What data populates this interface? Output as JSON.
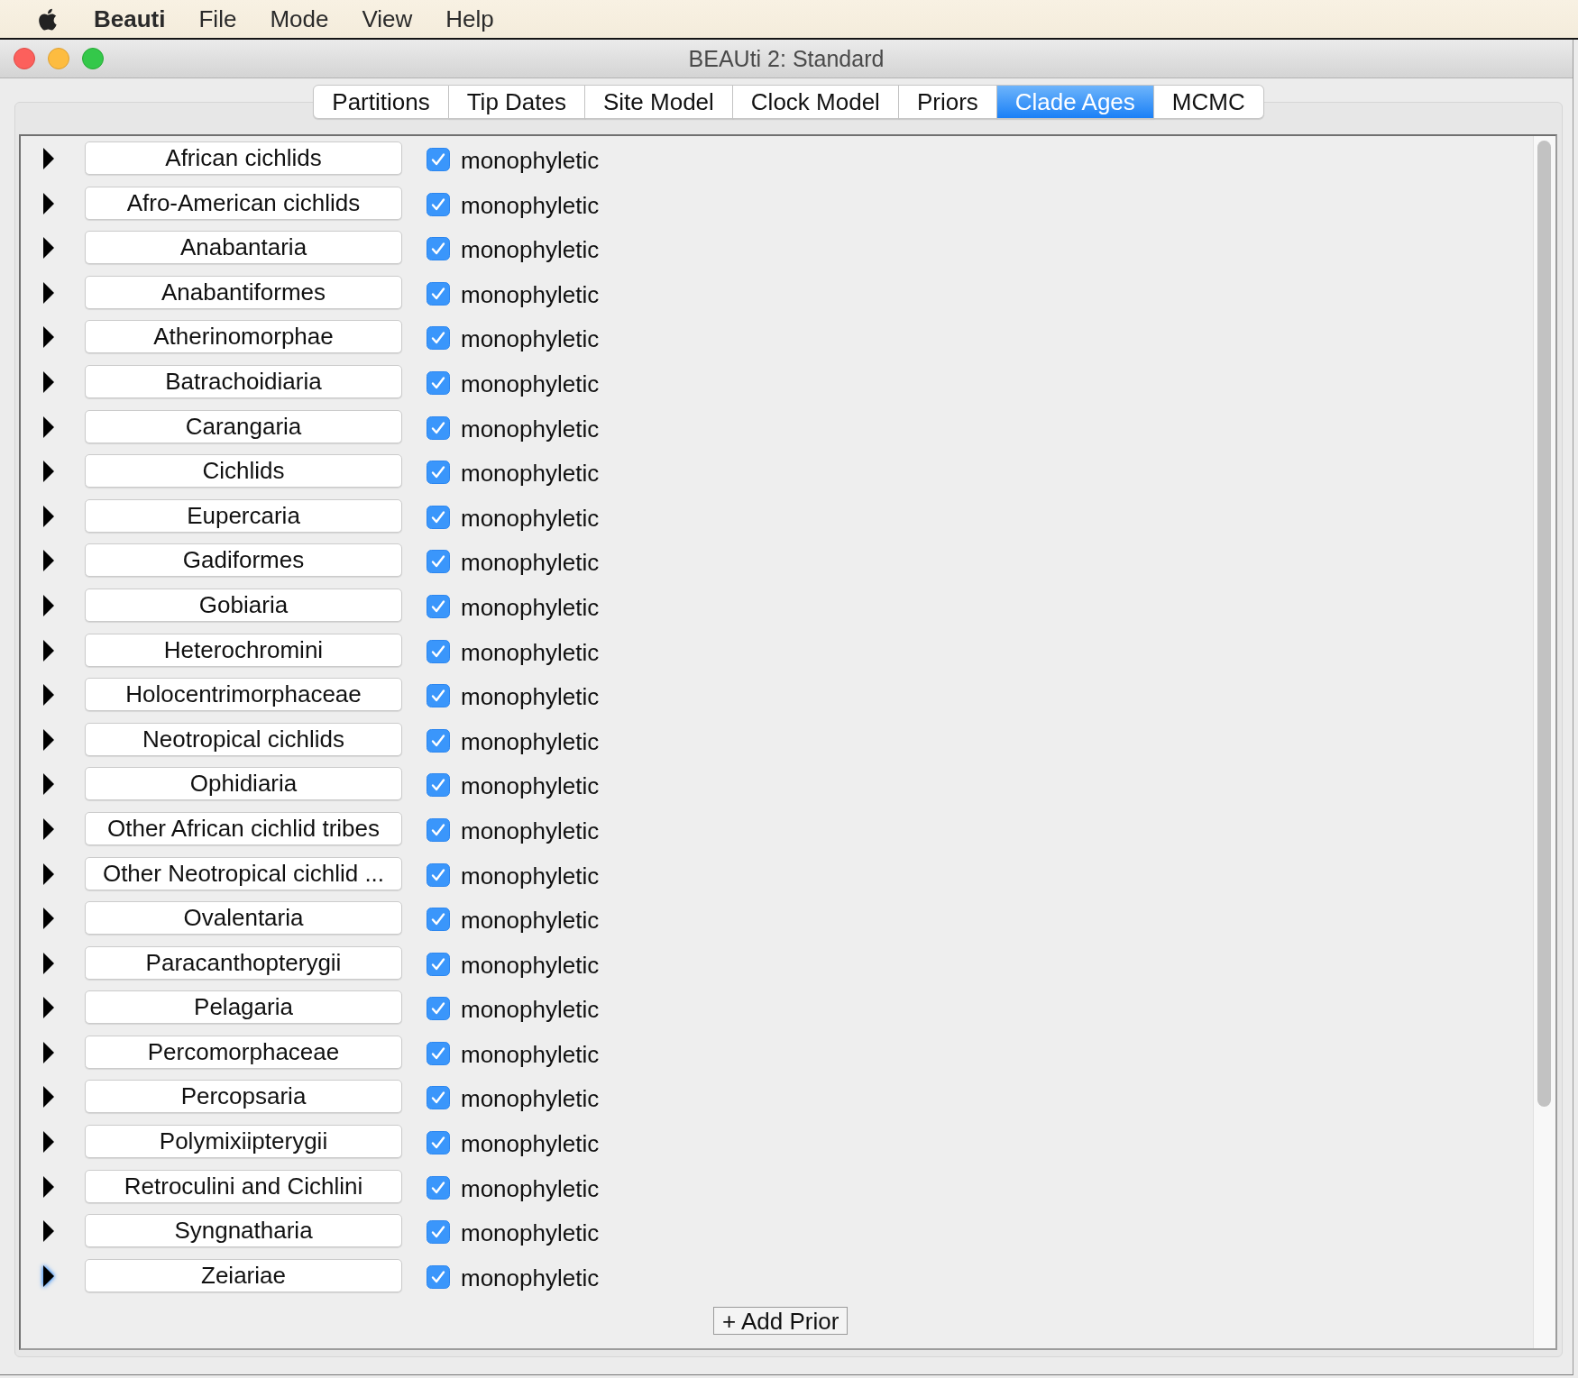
{
  "menu_bar": {
    "app_name": "Beauti",
    "items": [
      "File",
      "Mode",
      "View",
      "Help"
    ]
  },
  "window": {
    "title": "BEAUti 2: Standard"
  },
  "tabs": [
    {
      "label": "Partitions",
      "selected": false
    },
    {
      "label": "Tip Dates",
      "selected": false
    },
    {
      "label": "Site Model",
      "selected": false
    },
    {
      "label": "Clock Model",
      "selected": false
    },
    {
      "label": "Priors",
      "selected": false
    },
    {
      "label": "Clade Ages",
      "selected": true
    },
    {
      "label": "MCMC",
      "selected": false
    }
  ],
  "clades": [
    {
      "name": "African cichlids",
      "expanded": false,
      "focused": false,
      "checkbox": {
        "label": "monophyletic",
        "checked": true
      }
    },
    {
      "name": "Afro-American cichlids",
      "expanded": false,
      "focused": false,
      "checkbox": {
        "label": "monophyletic",
        "checked": true
      }
    },
    {
      "name": "Anabantaria",
      "expanded": false,
      "focused": false,
      "checkbox": {
        "label": "monophyletic",
        "checked": true
      }
    },
    {
      "name": "Anabantiformes",
      "expanded": false,
      "focused": false,
      "checkbox": {
        "label": "monophyletic",
        "checked": true
      }
    },
    {
      "name": "Atherinomorphae",
      "expanded": false,
      "focused": false,
      "checkbox": {
        "label": "monophyletic",
        "checked": true
      }
    },
    {
      "name": "Batrachoidiaria",
      "expanded": false,
      "focused": false,
      "checkbox": {
        "label": "monophyletic",
        "checked": true
      }
    },
    {
      "name": "Carangaria",
      "expanded": false,
      "focused": false,
      "checkbox": {
        "label": "monophyletic",
        "checked": true
      }
    },
    {
      "name": "Cichlids",
      "expanded": false,
      "focused": false,
      "checkbox": {
        "label": "monophyletic",
        "checked": true
      }
    },
    {
      "name": "Eupercaria",
      "expanded": false,
      "focused": false,
      "checkbox": {
        "label": "monophyletic",
        "checked": true
      }
    },
    {
      "name": "Gadiformes",
      "expanded": false,
      "focused": false,
      "checkbox": {
        "label": "monophyletic",
        "checked": true
      }
    },
    {
      "name": "Gobiaria",
      "expanded": false,
      "focused": false,
      "checkbox": {
        "label": "monophyletic",
        "checked": true
      }
    },
    {
      "name": "Heterochromini",
      "expanded": false,
      "focused": false,
      "checkbox": {
        "label": "monophyletic",
        "checked": true
      }
    },
    {
      "name": "Holocentrimorphaceae",
      "expanded": false,
      "focused": false,
      "checkbox": {
        "label": "monophyletic",
        "checked": true
      }
    },
    {
      "name": "Neotropical cichlids",
      "expanded": false,
      "focused": false,
      "checkbox": {
        "label": "monophyletic",
        "checked": true
      }
    },
    {
      "name": "Ophidiaria",
      "expanded": false,
      "focused": false,
      "checkbox": {
        "label": "monophyletic",
        "checked": true
      }
    },
    {
      "name": "Other African cichlid tribes",
      "expanded": false,
      "focused": false,
      "checkbox": {
        "label": "monophyletic",
        "checked": true
      }
    },
    {
      "name": "Other Neotropical cichlid ...",
      "expanded": false,
      "focused": false,
      "checkbox": {
        "label": "monophyletic",
        "checked": true
      }
    },
    {
      "name": "Ovalentaria",
      "expanded": false,
      "focused": false,
      "checkbox": {
        "label": "monophyletic",
        "checked": true
      }
    },
    {
      "name": "Paracanthopterygii",
      "expanded": false,
      "focused": false,
      "checkbox": {
        "label": "monophyletic",
        "checked": true
      }
    },
    {
      "name": "Pelagaria",
      "expanded": false,
      "focused": false,
      "checkbox": {
        "label": "monophyletic",
        "checked": true
      }
    },
    {
      "name": "Percomorphaceae",
      "expanded": false,
      "focused": false,
      "checkbox": {
        "label": "monophyletic",
        "checked": true
      }
    },
    {
      "name": "Percopsaria",
      "expanded": false,
      "focused": false,
      "checkbox": {
        "label": "monophyletic",
        "checked": true
      }
    },
    {
      "name": "Polymixiipterygii",
      "expanded": false,
      "focused": false,
      "checkbox": {
        "label": "monophyletic",
        "checked": true
      }
    },
    {
      "name": "Retroculini and Cichlini",
      "expanded": false,
      "focused": false,
      "checkbox": {
        "label": "monophyletic",
        "checked": true
      }
    },
    {
      "name": "Syngnatharia",
      "expanded": false,
      "focused": false,
      "checkbox": {
        "label": "monophyletic",
        "checked": true
      }
    },
    {
      "name": "Zeiariae",
      "expanded": false,
      "focused": true,
      "checkbox": {
        "label": "monophyletic",
        "checked": true
      }
    }
  ],
  "add_button": {
    "label": "+ Add Prior"
  }
}
